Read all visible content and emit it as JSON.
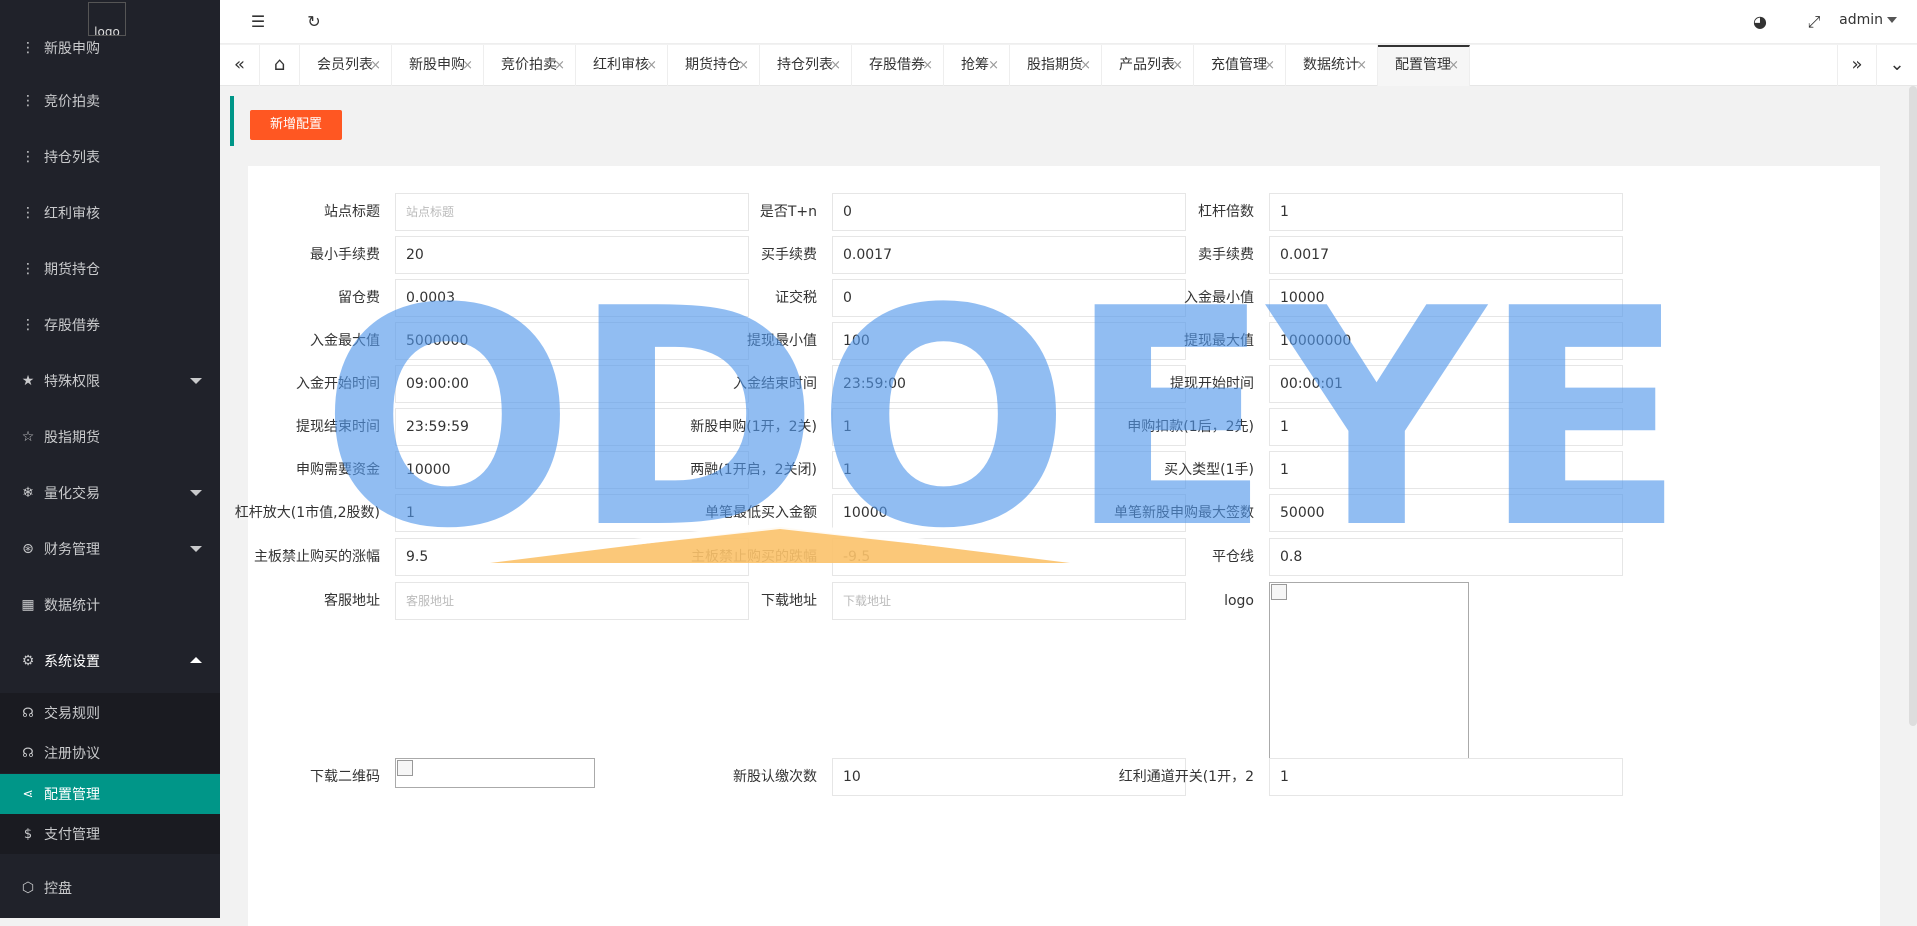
{
  "sidebar": {
    "logo_alt": "logo",
    "items": [
      {
        "label": "新股申购",
        "icon": "dots-icon"
      },
      {
        "label": "竞价拍卖",
        "icon": "dots-icon"
      },
      {
        "label": "持仓列表",
        "icon": "dots-icon"
      },
      {
        "label": "红利审核",
        "icon": "dots-icon"
      },
      {
        "label": "期货持仓",
        "icon": "dots-icon"
      },
      {
        "label": "存股借券",
        "icon": "dots-icon"
      },
      {
        "label": "特殊权限",
        "icon": "star-icon"
      },
      {
        "label": "股指期货",
        "icon": "star-outline-icon"
      },
      {
        "label": "量化交易",
        "icon": "snowflake-icon"
      },
      {
        "label": "财务管理",
        "icon": "finance-icon"
      },
      {
        "label": "数据统计",
        "icon": "calendar-icon"
      },
      {
        "label": "系统设置",
        "icon": "gear-icon"
      }
    ],
    "subitems": [
      {
        "label": "交易规则",
        "icon": "headset-icon"
      },
      {
        "label": "注册协议",
        "icon": "headset-icon"
      },
      {
        "label": "配置管理",
        "icon": "share-icon"
      },
      {
        "label": "支付管理",
        "icon": "dollar-icon"
      }
    ],
    "bottom": {
      "label": "控盘",
      "icon": "cube-icon"
    }
  },
  "header": {
    "user": "admin"
  },
  "tabs": [
    "会员列表",
    "新股申购",
    "竞价拍卖",
    "红利审核",
    "期货持仓",
    "持仓列表",
    "存股借券",
    "抢筹",
    "股指期货",
    "产品列表",
    "充值管理",
    "数据统计",
    "配置管理"
  ],
  "toolbar": {
    "add_label": "新增配置"
  },
  "form": {
    "rows": [
      [
        {
          "label": "站点标题",
          "value": "",
          "placeholder": "站点标题"
        },
        {
          "label": "是否T+n",
          "value": "0"
        },
        {
          "label": "杠杆倍数",
          "value": "1"
        }
      ],
      [
        {
          "label": "最小手续费",
          "value": "20"
        },
        {
          "label": "买手续费",
          "value": "0.0017"
        },
        {
          "label": "卖手续费",
          "value": "0.0017"
        }
      ],
      [
        {
          "label": "留仓费",
          "value": "0.0003"
        },
        {
          "label": "证交税",
          "value": "0"
        },
        {
          "label": "入金最小值",
          "value": "10000"
        }
      ],
      [
        {
          "label": "入金最大值",
          "value": "5000000"
        },
        {
          "label": "提现最小值",
          "value": "100"
        },
        {
          "label": "提现最大值",
          "value": "10000000"
        }
      ],
      [
        {
          "label": "入金开始时间",
          "value": "09:00:00"
        },
        {
          "label": "入金结束时间",
          "value": "23:59:00"
        },
        {
          "label": "提现开始时间",
          "value": "00:00:01"
        }
      ],
      [
        {
          "label": "提现结束时间",
          "value": "23:59:59"
        },
        {
          "label": "新股申购(1开，2关)",
          "value": "1"
        },
        {
          "label": "申购扣款(1后，2先)",
          "value": "1"
        }
      ],
      [
        {
          "label": "申购需要资金",
          "value": "10000"
        },
        {
          "label": "两融(1开启，2关闭)",
          "value": "1"
        },
        {
          "label": "买入类型(1手)",
          "value": "1"
        }
      ],
      [
        {
          "label": "杠杆放大(1市值,2股数)",
          "value": "1"
        },
        {
          "label": "单笔最低买入金额",
          "value": "10000"
        },
        {
          "label": "单笔新股申购最大签数",
          "value": "50000"
        }
      ],
      [
        {
          "label": "主板禁止购买的涨幅",
          "value": "9.5"
        },
        {
          "label": "主板禁止购买的跌幅",
          "value": "-9.5"
        },
        {
          "label": "平仓线",
          "value": "0.8"
        }
      ],
      [
        {
          "label": "客服地址",
          "value": "",
          "placeholder": "客服地址"
        },
        {
          "label": "下载地址",
          "value": "",
          "placeholder": "下载地址"
        },
        {
          "label": "logo",
          "value": ""
        }
      ],
      [
        {
          "label": "下载二维码",
          "value": ""
        },
        {
          "label": "新股认缴次数",
          "value": "10"
        },
        {
          "label": "红利通道开关(1开，2",
          "value": "1"
        }
      ]
    ]
  },
  "watermark": {
    "text": "ODOEYE",
    "color": "#4f95e8",
    "accent": "#fbc26a"
  }
}
